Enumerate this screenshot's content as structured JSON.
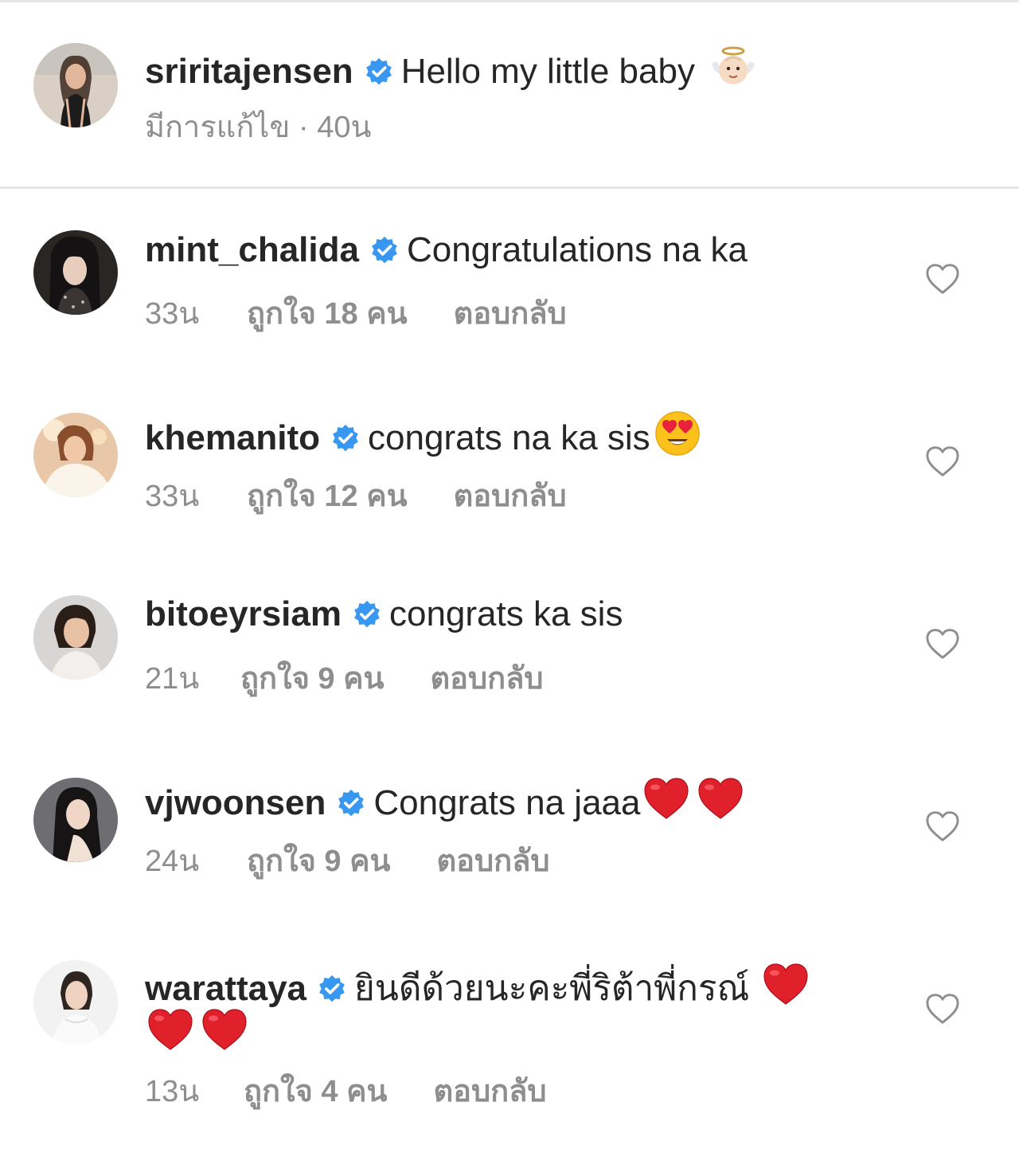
{
  "caption": {
    "username": "sriritajensen",
    "text": "Hello my little baby",
    "emoji": "angel-baby-emoji",
    "edited_label": "มีการแก้ไข",
    "separator": " · ",
    "time": "40น"
  },
  "reply_label": "ตอบกลับ",
  "comments": [
    {
      "username": "mint_chalida",
      "text": "Congratulations na ka",
      "time": "33น",
      "likes": "ถูกใจ 18 คน",
      "emojis": []
    },
    {
      "username": "khemanito",
      "text": "congrats na ka sis",
      "time": "33น",
      "likes": "ถูกใจ 12 คน",
      "emojis": [
        "heart-eyes-emoji"
      ]
    },
    {
      "username": "bitoeyrsiam",
      "text": "congrats ka sis",
      "time": "21น",
      "likes": "ถูกใจ 9 คน",
      "emojis": []
    },
    {
      "username": "vjwoonsen",
      "text": "Congrats na jaaa",
      "time": "24น",
      "likes": "ถูกใจ 9 คน",
      "emojis": [
        "red-heart-emoji",
        "red-heart-emoji"
      ]
    },
    {
      "username": "warattaya",
      "text": "ยินดีด้วยนะคะพี่ริต้าพี่กรณ์",
      "time": "13น",
      "likes": "ถูกใจ 4 คน",
      "emojis": [
        "red-heart-emoji",
        "red-heart-emoji",
        "red-heart-emoji"
      ]
    }
  ],
  "colors": {
    "verified_badge": "#3897f0",
    "meta_text": "#8e8e8e",
    "divider": "#e6e6e6",
    "heart_red": "#e0202b"
  },
  "icons": {
    "verified": "verified-badge-icon",
    "like": "heart-outline-icon"
  }
}
